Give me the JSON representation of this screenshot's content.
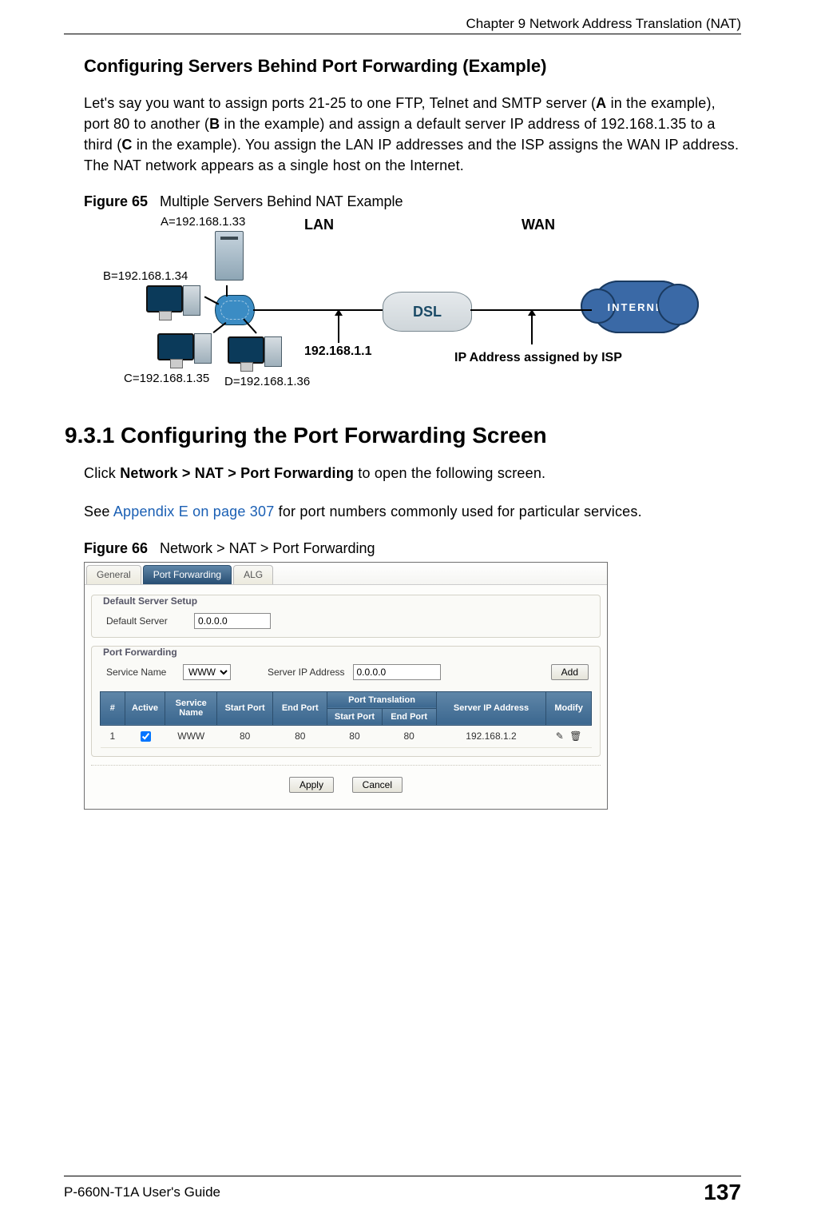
{
  "header": {
    "chapter": "Chapter 9 Network Address Translation (NAT)"
  },
  "section1": {
    "title": "Configuring Servers Behind Port Forwarding (Example)",
    "para_parts": {
      "p1": "Let's say you want to assign ports 21-25 to one FTP, Telnet and SMTP server (",
      "A": "A",
      "p2": " in the example), port 80 to another (",
      "B": "B",
      "p3": " in the example) and assign a default server IP address of 192.168.1.35 to a third (",
      "C": "C",
      "p4": " in the example). You assign the LAN IP addresses and the ISP assigns the WAN IP address. The NAT network appears as a single host on the Internet."
    }
  },
  "figure65": {
    "label": "Figure 65",
    "caption": "Multiple Servers Behind NAT Example",
    "labels": {
      "A": "A=192.168.1.33",
      "B": "B=192.168.1.34",
      "C": "C=192.168.1.35",
      "D": "D=192.168.1.36",
      "LAN": "LAN",
      "WAN": "WAN",
      "gw": "192.168.1.1",
      "isp": "IP Address assigned by ISP",
      "dsl": "DSL",
      "internet": "INTERNET"
    }
  },
  "section2": {
    "number_title": "9.3.1  Configuring the Port Forwarding Screen",
    "click_prefix": "Click ",
    "click_bold": "Network > NAT > Port Forwarding",
    "click_suffix": " to open the following screen.",
    "see_prefix": "See ",
    "see_link": "Appendix E on page 307",
    "see_suffix": " for port numbers commonly used for particular services."
  },
  "figure66": {
    "label": "Figure 66",
    "caption": "Network > NAT > Port Forwarding",
    "tabs": [
      "General",
      "Port Forwarding",
      "ALG"
    ],
    "active_tab_index": 1,
    "default_server_group": "Default Server Setup",
    "default_server_label": "Default Server",
    "default_server_value": "0.0.0.0",
    "pf_group": "Port Forwarding",
    "service_name_label": "Service Name",
    "service_name_value": "WWW",
    "server_ip_label": "Server IP Address",
    "server_ip_value": "0.0.0.0",
    "add_button": "Add",
    "columns": {
      "num": "#",
      "active": "Active",
      "service": "Service Name",
      "start": "Start Port",
      "end": "End Port",
      "trans": "Port Translation",
      "trans_start": "Start Port",
      "trans_end": "End Port",
      "sip": "Server IP Address",
      "modify": "Modify"
    },
    "rows": [
      {
        "num": "1",
        "active": true,
        "service": "WWW",
        "start": "80",
        "end": "80",
        "t_start": "80",
        "t_end": "80",
        "sip": "192.168.1.2"
      }
    ],
    "apply": "Apply",
    "cancel": "Cancel"
  },
  "footer": {
    "left": "P-660N-T1A User's Guide",
    "page": "137"
  }
}
